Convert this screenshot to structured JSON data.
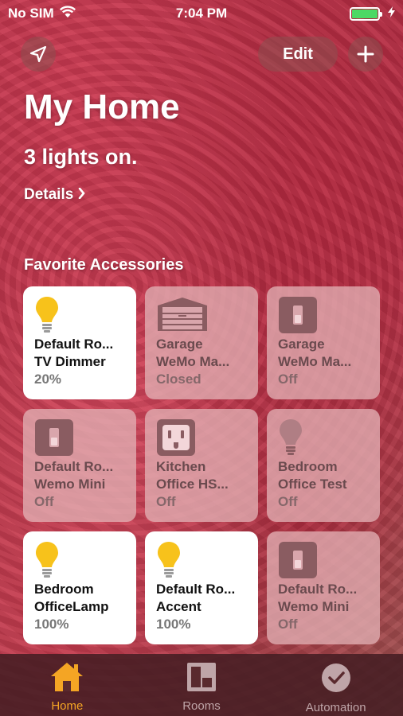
{
  "status_bar": {
    "carrier": "No SIM",
    "time": "7:04 PM",
    "battery_color": "#4cd964"
  },
  "header": {
    "location_icon": "location-arrow-icon",
    "edit_label": "Edit",
    "add_icon": "plus-icon",
    "title": "My Home",
    "subtitle": "3 lights on.",
    "details_label": "Details"
  },
  "favorites": {
    "section_title": "Favorite Accessories",
    "accessories": [
      {
        "line1": "Default Ro...",
        "line2": "TV Dimmer",
        "state": "20%",
        "on": true,
        "icon": "lightbulb-icon"
      },
      {
        "line1": "Garage",
        "line2": "WeMo Ma...",
        "state": "Closed",
        "on": false,
        "icon": "garage-door-icon"
      },
      {
        "line1": "Garage",
        "line2": "WeMo Ma...",
        "state": "Off",
        "on": false,
        "icon": "switch-icon"
      },
      {
        "line1": "Default Ro...",
        "line2": "Wemo Mini",
        "state": "Off",
        "on": false,
        "icon": "switch-icon"
      },
      {
        "line1": "Kitchen",
        "line2": "Office HS...",
        "state": "Off",
        "on": false,
        "icon": "outlet-icon"
      },
      {
        "line1": "Bedroom",
        "line2": "Office Test",
        "state": "Off",
        "on": false,
        "icon": "lightbulb-icon"
      },
      {
        "line1": "Bedroom",
        "line2": "OfficeLamp",
        "state": "100%",
        "on": true,
        "icon": "lightbulb-icon"
      },
      {
        "line1": "Default Ro...",
        "line2": "Accent",
        "state": "100%",
        "on": true,
        "icon": "lightbulb-icon"
      },
      {
        "line1": "Default Ro...",
        "line2": "Wemo Mini",
        "state": "Off",
        "on": false,
        "icon": "switch-icon"
      }
    ]
  },
  "tab_bar": {
    "tabs": [
      {
        "label": "Home",
        "icon": "home-icon",
        "active": true
      },
      {
        "label": "Rooms",
        "icon": "rooms-icon",
        "active": false
      },
      {
        "label": "Automation",
        "icon": "automation-clock-icon",
        "active": false
      }
    ],
    "active_color": "#f4a524"
  }
}
